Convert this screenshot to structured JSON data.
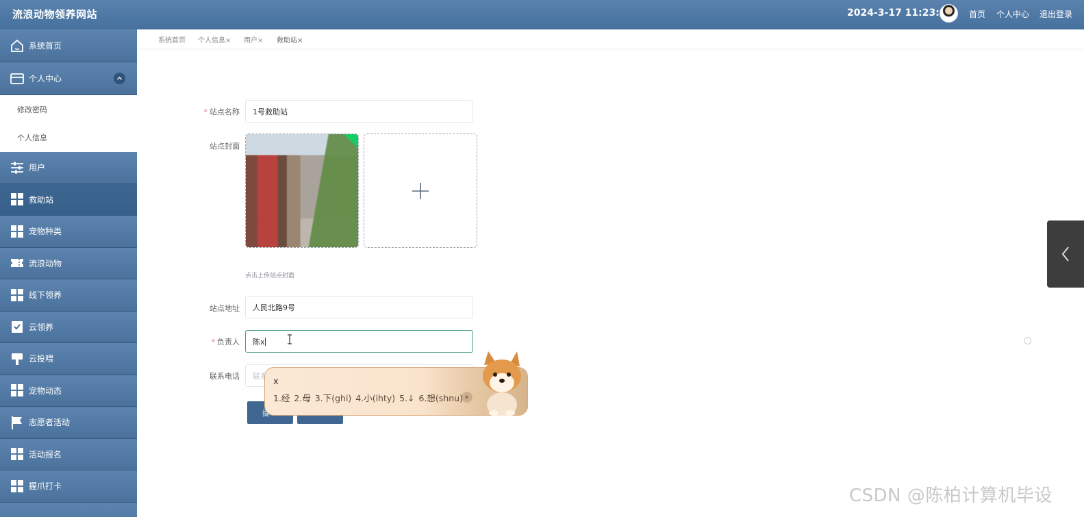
{
  "header": {
    "site_title": "流浪动物领养网站",
    "datetime": "2024-3-17 11:23:17",
    "links": [
      "首页",
      "个人中心",
      "退出登录"
    ]
  },
  "sidebar": {
    "items": [
      {
        "label": "系统首页",
        "icon": "home-icon"
      },
      {
        "label": "个人中心",
        "icon": "card-icon",
        "expanded": true
      },
      {
        "label": "用户",
        "icon": "sliders-icon"
      },
      {
        "label": "救助站",
        "icon": "grid-icon",
        "active": true
      },
      {
        "label": "宠物种类",
        "icon": "grid-icon"
      },
      {
        "label": "流浪动物",
        "icon": "ticket-icon"
      },
      {
        "label": "线下领养",
        "icon": "grid-icon"
      },
      {
        "label": "云领养",
        "icon": "clipboard-check-icon"
      },
      {
        "label": "云投喂",
        "icon": "brush-icon"
      },
      {
        "label": "宠物动态",
        "icon": "grid-icon"
      },
      {
        "label": "志愿者活动",
        "icon": "flag-icon"
      },
      {
        "label": "活动报名",
        "icon": "grid-icon"
      },
      {
        "label": "握爪打卡",
        "icon": "grid-icon"
      }
    ],
    "submenu": [
      "修改密码",
      "个人信息"
    ]
  },
  "tabs": [
    "系统首页",
    "个人信息×",
    "用户×",
    "救助站×"
  ],
  "form": {
    "station_name_label": "站点名称",
    "station_name_value": "1号救助站",
    "cover_label": "站点封面",
    "cover_hint": "点击上传站点封面",
    "address_label": "站点地址",
    "address_value": "人民北路9号",
    "manager_label": "负责人",
    "manager_value": "陈x",
    "phone_label": "联系电话",
    "phone_placeholder": "联系",
    "submit_label": "提"
  },
  "ime": {
    "composition": "x",
    "candidates": "1.经  2.母  3.下(ghi)  4.小(ihty)  5.↓  6.想(shnu)"
  },
  "watermark": "CSDN @陈柏计算机毕设",
  "colors": {
    "header": "#4f77a3",
    "sidebar": "#4a729c",
    "active": "#3a628d",
    "required": "#f56c6c",
    "focus_border": "#4a9c8a"
  }
}
